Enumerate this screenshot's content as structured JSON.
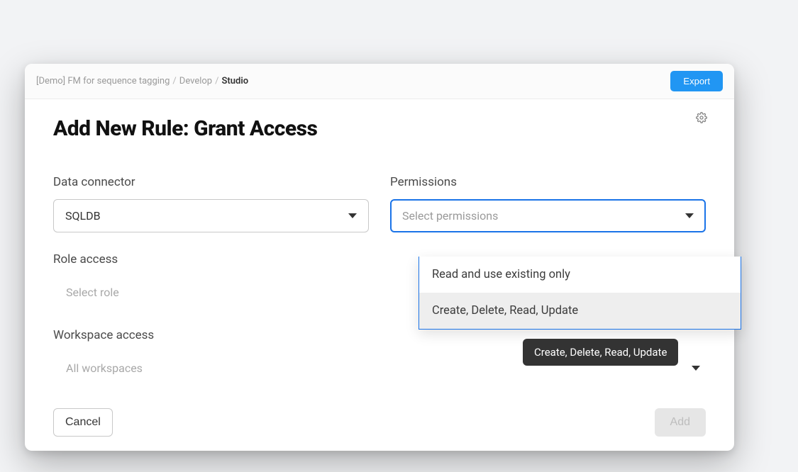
{
  "breadcrumb": {
    "items": [
      "[Demo] FM for sequence tagging",
      "Develop",
      "Studio"
    ],
    "separator": "/"
  },
  "export_label": "Export",
  "title": "Add New Rule: Grant Access",
  "fields": {
    "data_connector": {
      "label": "Data connector",
      "value": "SQLDB"
    },
    "permissions": {
      "label": "Permissions",
      "placeholder": "Select permissions",
      "options": [
        "Read and use existing only",
        "Create, Delete, Read, Update"
      ],
      "highlighted_index": 1
    },
    "role_access": {
      "label": "Role access",
      "placeholder": "Select role"
    },
    "workspace_access": {
      "label": "Workspace access",
      "placeholder": "All workspaces"
    }
  },
  "tooltip": "Create, Delete, Read, Update",
  "buttons": {
    "cancel": "Cancel",
    "add": "Add"
  }
}
